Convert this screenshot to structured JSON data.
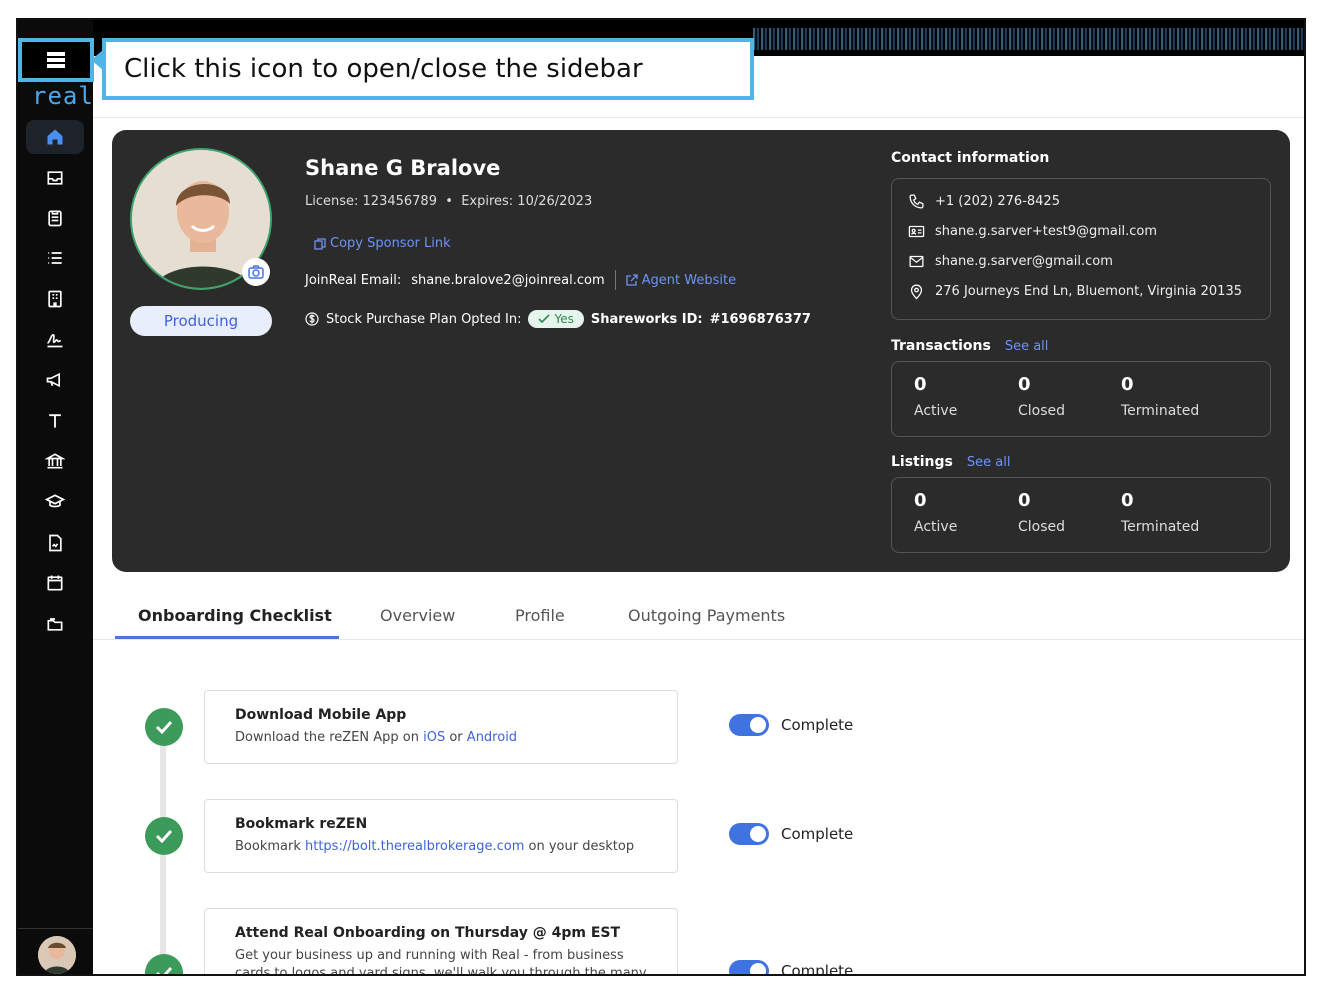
{
  "annotation": {
    "text": "Click this icon to open/close the sidebar"
  },
  "sidebar": {
    "logo": "real",
    "items": [
      {
        "name": "home",
        "icon": "home-icon"
      },
      {
        "name": "inbox",
        "icon": "inbox-icon"
      },
      {
        "name": "checklist",
        "icon": "clipboard-icon"
      },
      {
        "name": "list",
        "icon": "list-icon"
      },
      {
        "name": "building",
        "icon": "building-icon"
      },
      {
        "name": "signature",
        "icon": "signature-icon"
      },
      {
        "name": "announcements",
        "icon": "megaphone-icon"
      },
      {
        "name": "text",
        "icon": "text-icon"
      },
      {
        "name": "bank",
        "icon": "bank-icon"
      },
      {
        "name": "learning",
        "icon": "graduation-cap-icon"
      },
      {
        "name": "documents",
        "icon": "document-icon"
      },
      {
        "name": "calendar",
        "icon": "calendar-icon"
      },
      {
        "name": "folders",
        "icon": "folders-icon"
      }
    ]
  },
  "profile": {
    "name": "Shane G Bralove",
    "license": "License: 123456789",
    "expires": "Expires: 10/26/2023",
    "copy_sponsor_link": "Copy Sponsor Link",
    "joinreal_email_label": "JoinReal Email:",
    "joinreal_email": "shane.bralove2@joinreal.com",
    "agent_website": "Agent Website",
    "stock_label": "Stock Purchase Plan Opted In:",
    "stock_value": "Yes",
    "shareworks_label": "Shareworks ID:",
    "shareworks_id": "#1696876377",
    "status": "Producing"
  },
  "contact": {
    "title": "Contact information",
    "phone": "+1 (202) 276-8425",
    "email_work": "shane.g.sarver+test9@gmail.com",
    "email": "shane.g.sarver@gmail.com",
    "address": "276 Journeys End Ln, Bluemont, Virginia 20135"
  },
  "transactions": {
    "title": "Transactions",
    "see_all": "See all",
    "stats": [
      {
        "value": "0",
        "label": "Active"
      },
      {
        "value": "0",
        "label": "Closed"
      },
      {
        "value": "0",
        "label": "Terminated"
      }
    ]
  },
  "listings": {
    "title": "Listings",
    "see_all": "See all",
    "stats": [
      {
        "value": "0",
        "label": "Active"
      },
      {
        "value": "0",
        "label": "Closed"
      },
      {
        "value": "0",
        "label": "Terminated"
      }
    ]
  },
  "tabs": [
    "Onboarding Checklist",
    "Overview",
    "Profile",
    "Outgoing Payments"
  ],
  "checklist": [
    {
      "title": "Download Mobile App",
      "desc_prefix": "Download the reZEN App on ",
      "link1": "iOS",
      "desc_mid": " or ",
      "link2": "Android",
      "status": "Complete"
    },
    {
      "title": "Bookmark reZEN",
      "desc_prefix": "Bookmark ",
      "link1": "https://bolt.therealbrokerage.com",
      "desc_suffix": " on your desktop",
      "status": "Complete"
    },
    {
      "title": "Attend Real Onboarding on Thursday @ 4pm EST",
      "desc": "Get your business up and running with Real - from business cards to logos and yard signs, we'll walk you through the many resources",
      "status": "Complete"
    }
  ],
  "colors": {
    "accent": "#4a77de",
    "success": "#3c9a5b",
    "card_bg": "#2b2b2b",
    "highlight": "#4fb4e6"
  }
}
